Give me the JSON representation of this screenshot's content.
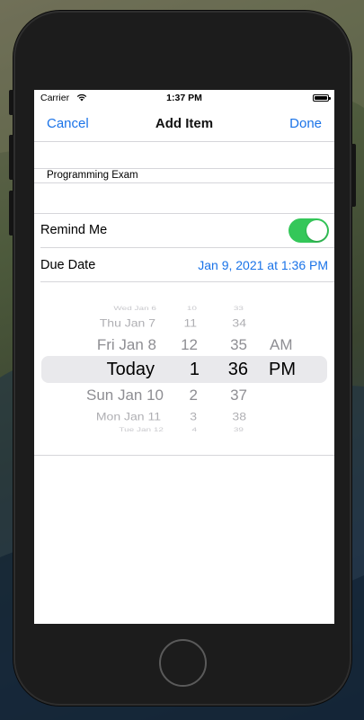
{
  "status_bar": {
    "carrier": "Carrier",
    "time": "1:37 PM"
  },
  "nav": {
    "cancel": "Cancel",
    "title": "Add Item",
    "done": "Done"
  },
  "form": {
    "title_value": "Programming Exam",
    "remind_label": "Remind Me",
    "remind_on": true,
    "due_label": "Due Date",
    "due_value": "Jan 9, 2021 at 1:36 PM"
  },
  "picker": {
    "rows": [
      {
        "date": "Wed Jan 6",
        "hour": "10",
        "minute": "33",
        "ampm": ""
      },
      {
        "date": "Thu Jan 7",
        "hour": "11",
        "minute": "34",
        "ampm": ""
      },
      {
        "date": "Fri Jan 8",
        "hour": "12",
        "minute": "35",
        "ampm": "AM"
      },
      {
        "date": "Today",
        "hour": "1",
        "minute": "36",
        "ampm": "PM"
      },
      {
        "date": "Sun Jan 10",
        "hour": "2",
        "minute": "37",
        "ampm": ""
      },
      {
        "date": "Mon Jan 11",
        "hour": "3",
        "minute": "38",
        "ampm": ""
      },
      {
        "date": "Tue Jan 12",
        "hour": "4",
        "minute": "39",
        "ampm": ""
      }
    ]
  },
  "colors": {
    "accent": "#1a73e8",
    "toggle_on": "#34c759"
  }
}
